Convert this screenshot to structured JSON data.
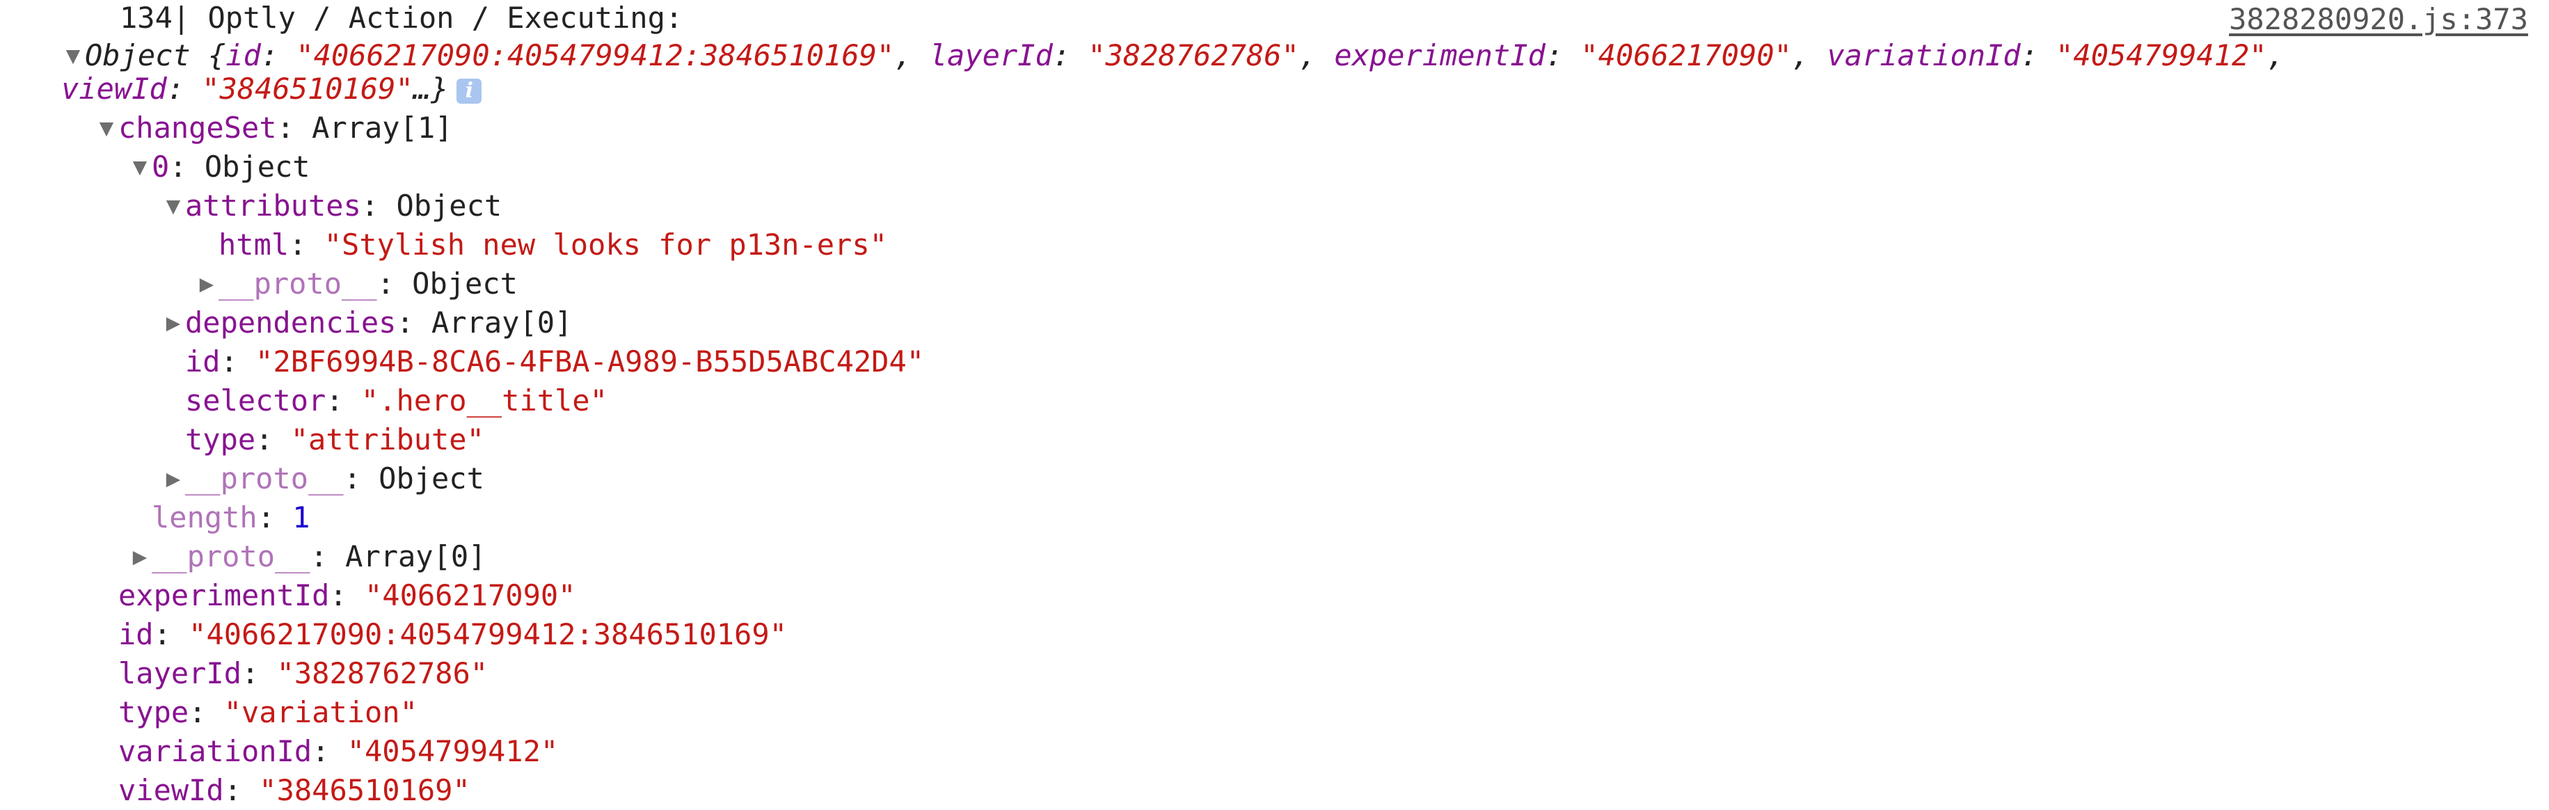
{
  "header": {
    "line_number": "134",
    "separator": "|",
    "message": " Optly / Action / Executing:",
    "source_link": "3828280920.js:373"
  },
  "summary": {
    "type_label": "Object",
    "open": " {",
    "id_key": "id",
    "id_value": "\"4066217090:4054799412:3846510169\"",
    "layer_key": "layerId",
    "layer_value": "\"3828762786\"",
    "experiment_key": "experimentId",
    "experiment_value": "\"4066217090\"",
    "variation_key": "variationId",
    "variation_value": "\"4054799412\"",
    "view_key": "viewId",
    "view_value": "\"3846510169\"",
    "close": "…}",
    "info_badge": "i"
  },
  "tree": {
    "changeset": {
      "key": "changeSet",
      "value": "Array[1]"
    },
    "item0": {
      "key": "0",
      "value": "Object"
    },
    "attributes": {
      "key": "attributes",
      "value": "Object"
    },
    "html": {
      "key": "html",
      "value": "\"Stylish new looks for p13n-ers\""
    },
    "attr_proto": {
      "key": "__proto__",
      "value": "Object"
    },
    "dependencies": {
      "key": "dependencies",
      "value": "Array[0]"
    },
    "item_id": {
      "key": "id",
      "value": "\"2BF6994B-8CA6-4FBA-A989-B55D5ABC42D4\""
    },
    "selector": {
      "key": "selector",
      "value": "\".hero__title\""
    },
    "type": {
      "key": "type",
      "value": "\"attribute\""
    },
    "item_proto": {
      "key": "__proto__",
      "value": "Object"
    },
    "length": {
      "key": "length",
      "value": "1"
    },
    "array_proto": {
      "key": "__proto__",
      "value": "Array[0]"
    },
    "experimentId": {
      "key": "experimentId",
      "value": "\"4066217090\""
    },
    "id": {
      "key": "id",
      "value": "\"4066217090:4054799412:3846510169\""
    },
    "layerId": {
      "key": "layerId",
      "value": "\"3828762786\""
    },
    "typeRoot": {
      "key": "type",
      "value": "\"variation\""
    },
    "variationId": {
      "key": "variationId",
      "value": "\"4054799412\""
    },
    "viewId": {
      "key": "viewId",
      "value": "\"3846510169\""
    }
  },
  "icons": {
    "expanded": "▼",
    "collapsed": "▶"
  }
}
